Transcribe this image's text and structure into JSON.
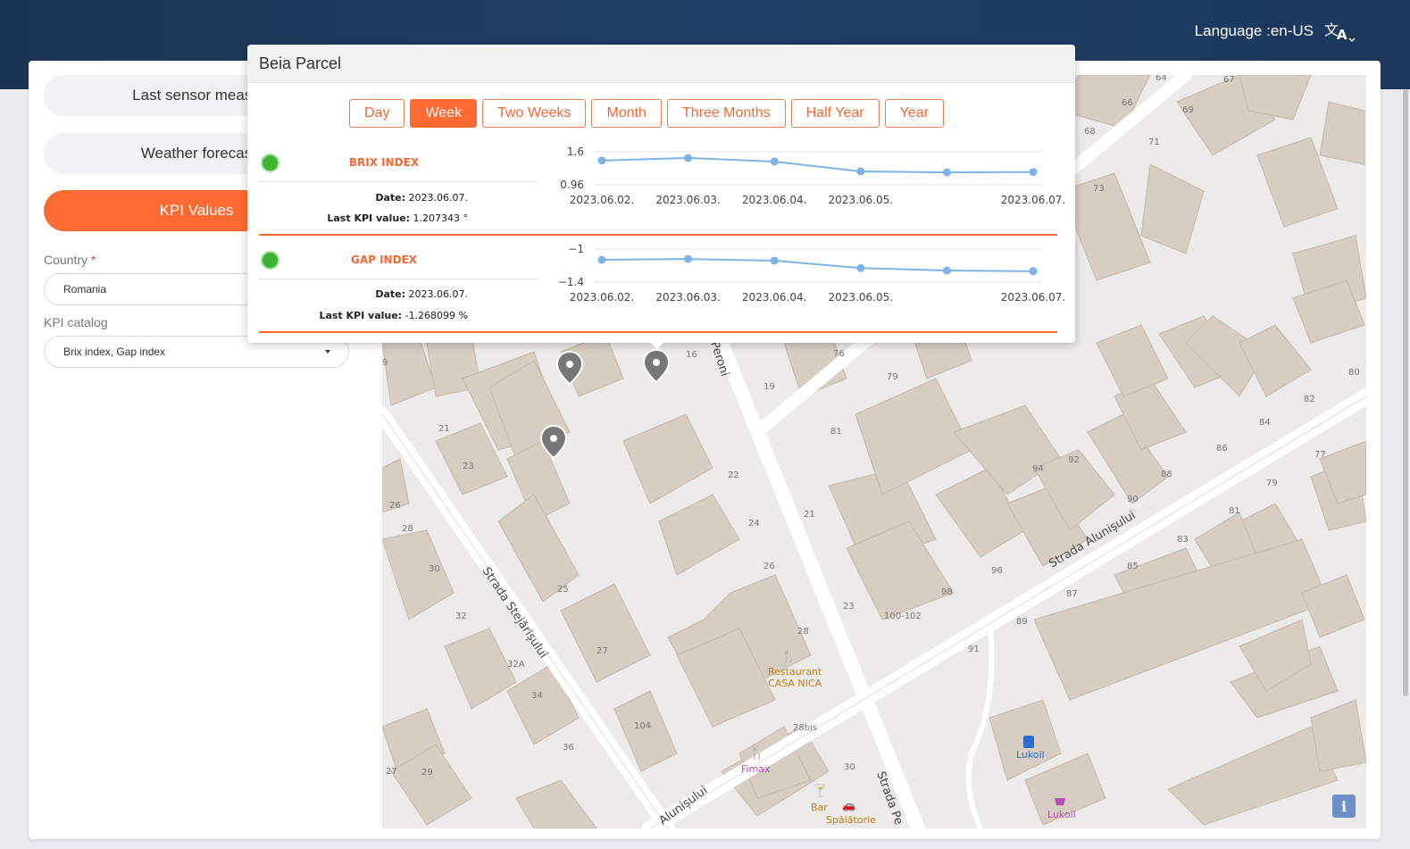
{
  "header": {
    "language_label": "Language :",
    "language_value": "en-US",
    "language_icon": "translate-icon"
  },
  "sidebar": {
    "buttons": [
      {
        "label": "Last sensor measu",
        "active": false
      },
      {
        "label": "Weather forecas",
        "active": false
      },
      {
        "label": "KPI Values",
        "active": true
      }
    ],
    "country_label": "Country",
    "country_required": "*",
    "country_value": "Romania",
    "kpi_catalog_label": "KPI catalog",
    "kpi_catalog_value": "Brix index, Gap index"
  },
  "popup": {
    "title": "Beia Parcel",
    "periods": [
      "Day",
      "Week",
      "Two Weeks",
      "Month",
      "Three Months",
      "Half Year",
      "Year"
    ],
    "active_period": "Week",
    "kpis": [
      {
        "name": "BRIX INDEX",
        "date_label": "Date:",
        "date_value": "2023.06.07.",
        "last_label": "Last KPI value:",
        "last_value": "1.207343 °",
        "status_icon": "sensor-status-icon"
      },
      {
        "name": "GAP INDEX",
        "date_label": "Date:",
        "date_value": "2023.06.07.",
        "last_label": "Last KPI value:",
        "last_value": "-1.268099 %",
        "status_icon": "sensor-status-icon"
      }
    ]
  },
  "chart_data": [
    {
      "type": "line",
      "x": [
        "2023.06.02.",
        "2023.06.03.",
        "2023.06.04.",
        "2023.06.05.",
        "2023.06.06.",
        "2023.06.07."
      ],
      "xticks": [
        "2023.06.02.",
        "2023.06.03.",
        "2023.06.04.",
        "2023.06.05.",
        "2023.06.07."
      ],
      "series": [
        {
          "values": [
            1.43,
            1.48,
            1.41,
            1.22,
            1.2,
            1.207343
          ]
        }
      ],
      "yticks": [
        "1.6",
        "0.96"
      ],
      "ylim": [
        0.96,
        1.6
      ],
      "color": "#7fb2e5"
    },
    {
      "type": "line",
      "x": [
        "2023.06.02.",
        "2023.06.03.",
        "2023.06.04.",
        "2023.06.05.",
        "2023.06.06.",
        "2023.06.07."
      ],
      "xticks": [
        "2023.06.02.",
        "2023.06.03.",
        "2023.06.04.",
        "2023.06.05.",
        "2023.06.07."
      ],
      "series": [
        {
          "values": [
            -1.13,
            -1.12,
            -1.14,
            -1.23,
            -1.26,
            -1.268099
          ]
        }
      ],
      "yticks": [
        "−1",
        "−1.4"
      ],
      "ylim": [
        -1.4,
        -1.0
      ],
      "color": "#7fb2e5"
    }
  ],
  "map": {
    "street_labels": [
      "Strada Stejărișului",
      "Strada Alunișului",
      "Peroni",
      "Strada Pe",
      "Alunișului"
    ],
    "house_numbers": [
      "64",
      "67",
      "66",
      "69",
      "68",
      "71",
      "73",
      "16",
      "76",
      "19",
      "79",
      "9",
      "21",
      "81",
      "23",
      "22",
      "26",
      "24",
      "21",
      "28",
      "30",
      "25",
      "26",
      "27",
      "32",
      "32A",
      "23",
      "100-102",
      "98",
      "96",
      "94",
      "92",
      "90",
      "88",
      "86",
      "84",
      "82",
      "80",
      "77",
      "79",
      "81",
      "83",
      "85",
      "87",
      "89",
      "91",
      "34",
      "36",
      "104",
      "28",
      "28bis",
      "30",
      "27",
      "29"
    ],
    "poi": [
      {
        "name": "Restaurant CASA NICA",
        "icon": "restaurant-icon",
        "color": "#c77d16"
      },
      {
        "name": "Fimax",
        "icon": "shop-icon",
        "color": "#b64fb4"
      },
      {
        "name": "Bar",
        "icon": "bar-icon",
        "color": "#c77d16"
      },
      {
        "name": "Spălătorie",
        "icon": "car-wash-icon",
        "color": "#c77d16"
      },
      {
        "name": "Lukoil",
        "icon": "fuel-icon",
        "color": "#2a6cd1"
      },
      {
        "name": "Lukoil",
        "icon": "shop-basket-icon",
        "color": "#b64fb4"
      }
    ],
    "info_label": "i"
  }
}
